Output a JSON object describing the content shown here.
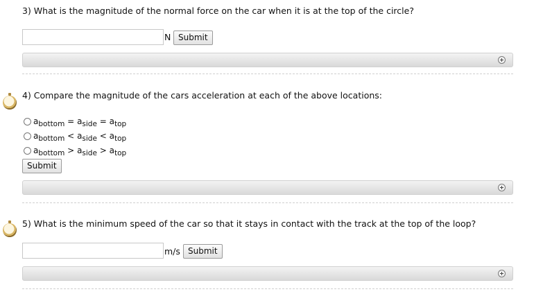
{
  "q3": {
    "title": "3) What is the magnitude of the normal force on the car when it is at the top of the circle?",
    "input_value": "",
    "unit": "N",
    "submit_label": "Submit"
  },
  "q4": {
    "title": "4) Compare the magnitude of the cars acceleration at each of the above locations:",
    "options": [
      {
        "a1": "a",
        "s1": "bottom",
        "op1": "=",
        "a2": "a",
        "s2": "side",
        "op2": "=",
        "a3": "a",
        "s3": "top"
      },
      {
        "a1": "a",
        "s1": "bottom",
        "op1": "<",
        "a2": "a",
        "s2": "side",
        "op2": "<",
        "a3": "a",
        "s3": "top"
      },
      {
        "a1": "a",
        "s1": "bottom",
        "op1": ">",
        "a2": "a",
        "s2": "side",
        "op2": ">",
        "a3": "a",
        "s3": "top"
      }
    ],
    "submit_label": "Submit"
  },
  "q5": {
    "title": "5) What is the minimum speed of the car so that it stays in contact with the track at the top of the loop?",
    "input_value": "",
    "unit": "m/s",
    "submit_label": "Submit"
  },
  "icons": {
    "timer": "stopwatch-icon",
    "expand": "plus-circle-icon"
  }
}
